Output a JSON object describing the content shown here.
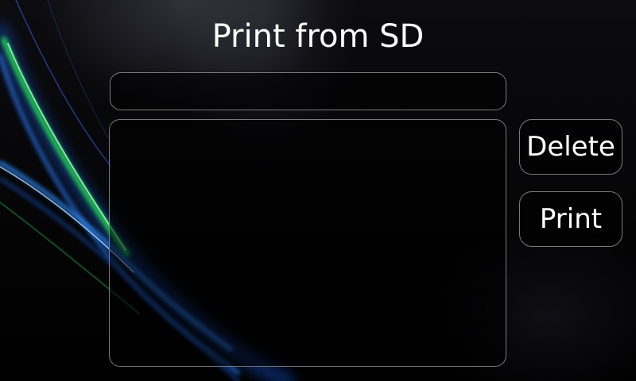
{
  "screen": {
    "title": "Print from SD"
  },
  "path_box": {
    "value": ""
  },
  "file_list": {
    "items": []
  },
  "buttons": {
    "delete_label": "Delete",
    "print_label": "Print"
  }
}
